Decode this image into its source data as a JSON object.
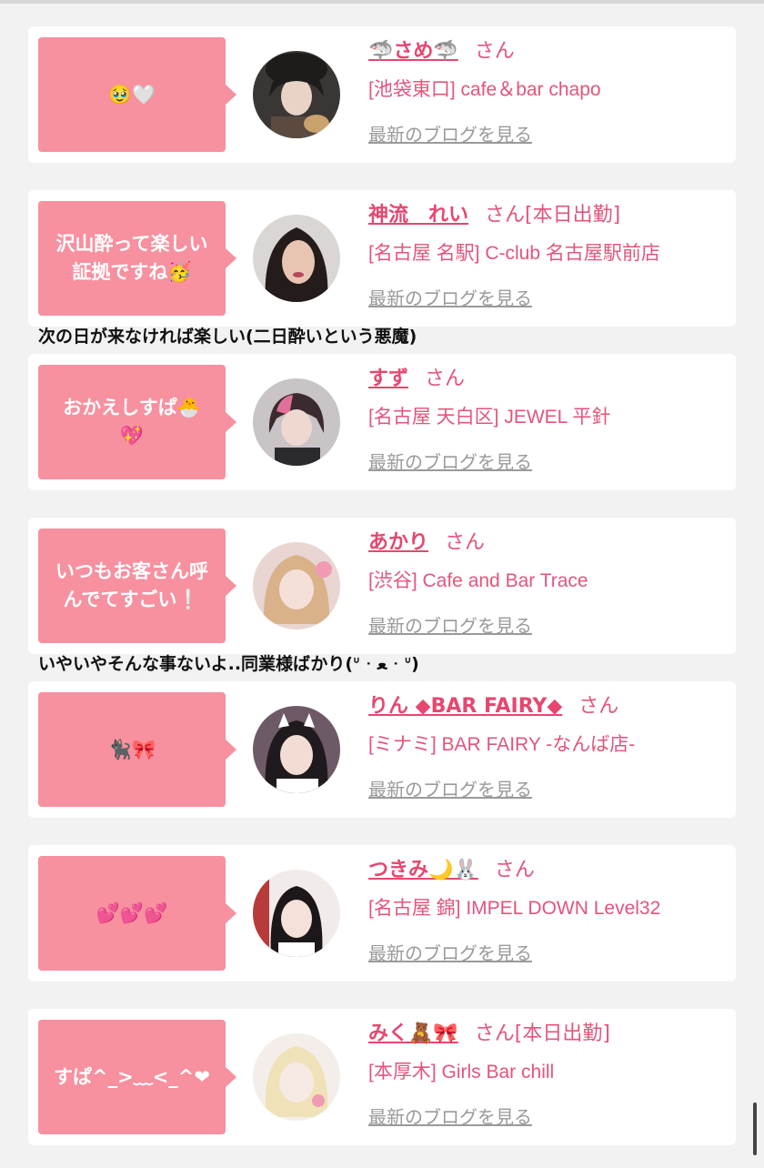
{
  "colors": {
    "bubble": "#f7909f",
    "accent": "#e6476f",
    "link_gray": "#9a9a9a",
    "card": "#ffffff",
    "page_bg": "#f2f2f3"
  },
  "entries": [
    {
      "comment": "🥹🤍",
      "name": "🦈さめ🦈",
      "suffix": "さん",
      "shop": "[池袋東口] cafe＆bar chapo",
      "blog": "最新のブログを見る"
    },
    {
      "comment": "沢山酔って楽しい\n証拠ですね🥳",
      "name": "神流　れい",
      "suffix": "さん[本日出勤]",
      "shop": "[名古屋 名駅] C-club 名古屋駅前店",
      "blog": "最新のブログを見る",
      "reply": "次の日が来なければ楽しい(二日酔いという悪魔)"
    },
    {
      "comment": "おかえしすぱ🐣\n💖",
      "name": "すず",
      "suffix": "さん",
      "shop": "[名古屋 天白区] JEWEL 平針",
      "blog": "最新のブログを見る"
    },
    {
      "comment": "いつもお客さん呼\nんでてすごい❕",
      "name": "あかり",
      "suffix": "さん",
      "shop": "[渋谷] Cafe and Bar Trace",
      "blog": "最新のブログを見る",
      "reply": "いやいやそんな事ないよ..同業様ばかり(ᐡ ᐧ ﻌ ᐧ ᐡ)"
    },
    {
      "comment": "🐈‍⬛🎀",
      "name": "りん ◆BAR FAIRY◆",
      "suffix": "さん",
      "shop": "[ミナミ] BAR FAIRY -なんば店-",
      "blog": "最新のブログを見る"
    },
    {
      "comment": "💕💕💕",
      "name": "つきみ🌙🐰",
      "suffix": "さん",
      "shop": "[名古屋 錦] IMPEL DOWN Level32",
      "blog": "最新のブログを見る"
    },
    {
      "comment": "すぱ^_>﹏<_^❤",
      "name": "みく🧸🎀",
      "suffix": "さん[本日出勤]",
      "shop": "[本厚木] Girls Bar chill",
      "blog": "最新のブログを見る"
    }
  ]
}
